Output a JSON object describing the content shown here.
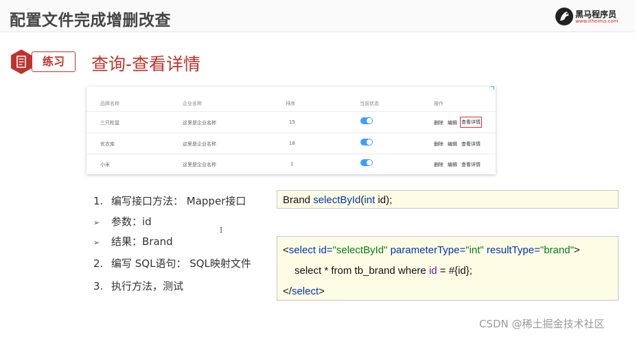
{
  "header": {
    "title": "配置文件完成增删改查"
  },
  "logo": {
    "name": "黑马程序员",
    "url": "www.itheima.com"
  },
  "section": {
    "tag": "练习",
    "title": "查询-查看详情"
  },
  "table": {
    "headers": [
      "品牌名称",
      "企业名称",
      "排序",
      "当前状态",
      "操作"
    ],
    "rows": [
      {
        "brand": "三只松鼠",
        "company": "这里是企业名称",
        "order": "15",
        "status_on": true
      },
      {
        "brand": "优衣库",
        "company": "这里是企业名称",
        "order": "18",
        "status_on": true
      },
      {
        "brand": "小米",
        "company": "这里是企业名称",
        "order": "1",
        "status_on": true
      }
    ],
    "actions": {
      "delete": "删除",
      "edit": "编辑",
      "details": "查看详情"
    },
    "accent_color": "#409eff",
    "highlight_color": "#d9302c"
  },
  "steps": [
    {
      "marker": "1.",
      "text": "编写接口方法： Mapper接口"
    },
    {
      "marker": "➢",
      "text": "参数：id"
    },
    {
      "marker": "➢",
      "text": "结果：Brand"
    },
    {
      "marker": "2.",
      "text": "编写 SQL语句： SQL映射文件"
    },
    {
      "marker": "3.",
      "text": "执行方法，测试"
    }
  ],
  "code1": {
    "type": "Brand",
    "method": "selectById",
    "paren_open": "(",
    "ptype": "int",
    "pname": " id);"
  },
  "code2": {
    "l1_open": "<",
    "l1_tag": "select",
    "a1": "id=",
    "v1": "\"selectById\"",
    "a2": "parameterType=",
    "v2": "\"int\"",
    "a3": "resultType=",
    "v3": "\"brand\"",
    "l1_close": ">",
    "l2_pre": "select * from tb_brand where ",
    "l2_id": "id",
    "l2_post": " = #{id};",
    "l3_open": "</",
    "l3_tag": "select",
    "l3_close": ">"
  },
  "cursor_glyph": "I",
  "watermark": "CSDN @稀土掘金技术社区",
  "brand_color": "#c0332b"
}
